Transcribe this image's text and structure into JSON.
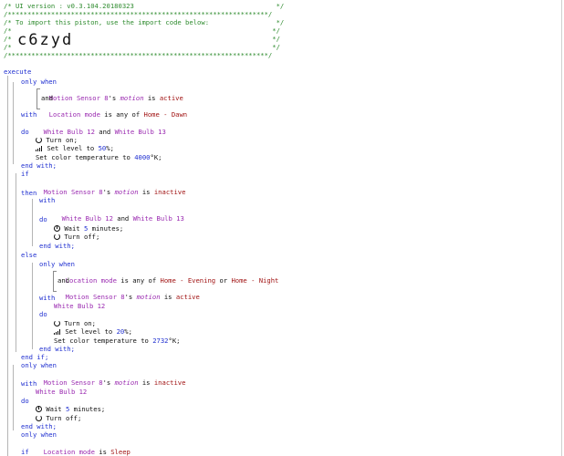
{
  "header": {
    "version_line": "/* UI version : v0.3.104.20180323                                    */",
    "stars_top": "/******************************************************************/",
    "import_line": "/* To import this piston, use the import code below:                 */",
    "blank1": "/*                                                                  */",
    "blank2": "/*                                                                  */",
    "blank3": "/*                                                                  */",
    "stars_bottom": "/******************************************************************/",
    "import_code": "c6zyd"
  },
  "script": {
    "execute": "execute",
    "only_when": "only when",
    "motion_sensor": "Motion Sensor 8",
    "apostrophe_s": "'s",
    "motion": "motion",
    "is": "is",
    "active": "active",
    "inactive": "inactive",
    "and": "and",
    "location_mode": "Location mode",
    "is_any_of": "is any of",
    "home_dawn": "Home - Dawn",
    "home_evening": "Home - Evening",
    "home_night": "Home - Night",
    "or": "or",
    "with": "with",
    "white_bulb_12": "White Bulb 12",
    "white_bulb_13": "White Bulb 13",
    "do": "do",
    "turn_on": "Turn on;",
    "set_level_to": "Set level to",
    "level_50": "50",
    "level_20": "20",
    "pct": "%;",
    "set_color_temp": "Set color temperature to",
    "temp_4000": "4000",
    "temp_2732": "2732",
    "kelvin": "°K;",
    "end_with": "end with;",
    "if": "if",
    "then": "then",
    "wait": "Wait",
    "five": "5",
    "minutes": "minutes;",
    "turn_off": "Turn off;",
    "else": "else",
    "end_if": "end if;",
    "sleep": "Sleep"
  }
}
